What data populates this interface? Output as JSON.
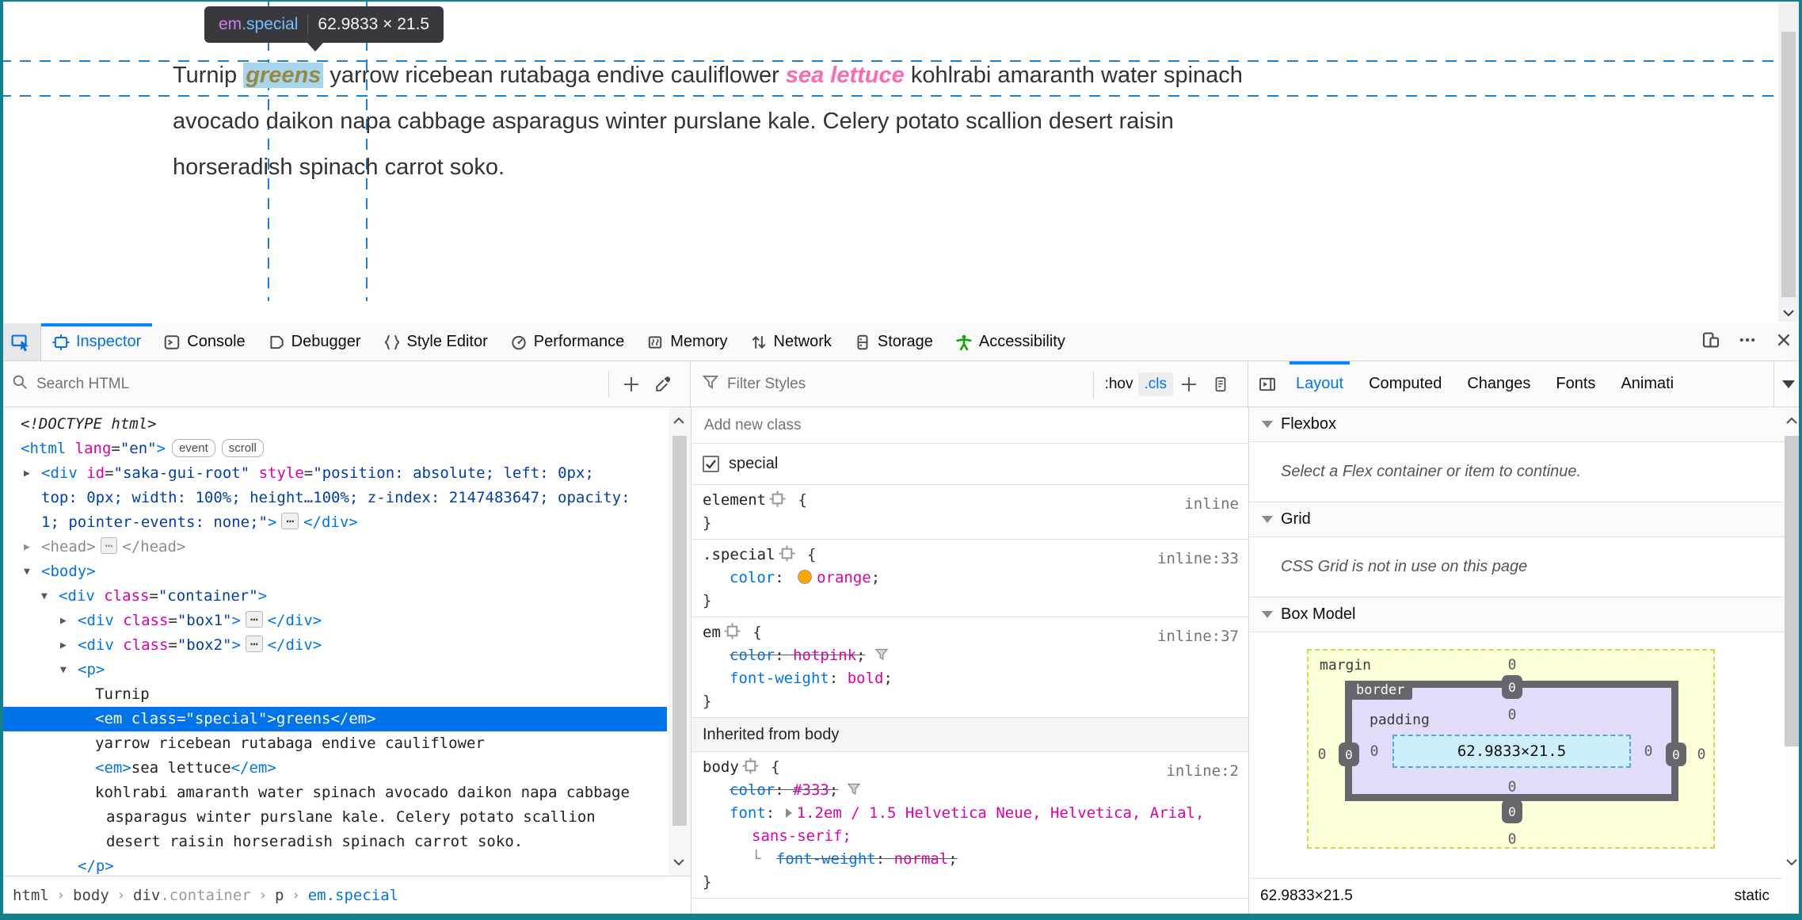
{
  "colors": {
    "accent": "#0074e8",
    "edge_teal": "#147f8e",
    "selection": "#0074e8",
    "hotpink": "#ff69b4",
    "orange_swatch": "#ffa500",
    "guide_blue": "#1a83d8"
  },
  "tooltip": {
    "tag": "em",
    "cls": ".special",
    "dims": "62.9833 × 21.5"
  },
  "page": {
    "lines": [
      [
        [
          "plain",
          "Turnip "
        ],
        [
          "special",
          "greens"
        ],
        [
          "plain",
          " yarrow ricebean rutabaga endive cauliflower "
        ],
        [
          "em",
          "sea lettuce"
        ],
        [
          "plain",
          " kohlrabi amaranth water spinach"
        ]
      ],
      [
        [
          "plain",
          "avocado daikon napa cabbage asparagus winter purslane kale. Celery potato scallion desert raisin"
        ]
      ],
      [
        [
          "plain",
          "horseradish spinach carrot soko."
        ]
      ]
    ]
  },
  "toolbar": {
    "picker_icon": "pick-element-icon",
    "tabs": [
      {
        "label": "Inspector",
        "icon": "inspector",
        "active": true
      },
      {
        "label": "Console",
        "icon": "console",
        "active": false
      },
      {
        "label": "Debugger",
        "icon": "debugger",
        "active": false
      },
      {
        "label": "Style Editor",
        "icon": "braces",
        "active": false
      },
      {
        "label": "Performance",
        "icon": "performance",
        "active": false
      },
      {
        "label": "Memory",
        "icon": "memory",
        "active": false
      },
      {
        "label": "Network",
        "icon": "network",
        "active": false
      },
      {
        "label": "Storage",
        "icon": "storage",
        "active": false
      },
      {
        "label": "Accessibility",
        "icon": "accessibility",
        "active": false
      }
    ],
    "window_buttons": [
      "responsive",
      "meatballs",
      "close"
    ]
  },
  "subbar": {
    "search_placeholder": "Search HTML",
    "filter_placeholder": "Filter Styles",
    "pseudo_label": ":hov",
    "cls_label": ".cls",
    "sidebar_tabs": [
      {
        "label": "Layout",
        "active": true
      },
      {
        "label": "Computed",
        "active": false
      },
      {
        "label": "Changes",
        "active": false
      },
      {
        "label": "Fonts",
        "active": false
      },
      {
        "label": "Animati",
        "active": false
      }
    ]
  },
  "markup": {
    "rows": [
      {
        "ind": 26,
        "parts": [
          [
            "doc",
            "<!DOCTYPE html>"
          ]
        ]
      },
      {
        "ind": 26,
        "parts": [
          [
            "tag",
            "<html"
          ],
          [
            "atn",
            " lang"
          ],
          [
            "eq",
            "="
          ],
          [
            "atv",
            "\"en\""
          ],
          [
            "tag",
            ">"
          ],
          [
            "badge",
            "event"
          ],
          [
            "badge",
            "scroll"
          ]
        ]
      },
      {
        "ind": 30,
        "exp": "closed",
        "parts": [
          [
            "tag",
            "<div"
          ],
          [
            "atn",
            " id"
          ],
          [
            "eq",
            "="
          ],
          [
            "atv",
            "\"saka-gui-root\""
          ],
          [
            "atn",
            " style"
          ],
          [
            "eq",
            "="
          ],
          [
            "atv",
            "\"position: absolute; left: 0px;"
          ]
        ]
      },
      {
        "ind": 52,
        "parts": [
          [
            "atv",
            "top: 0px; width: 100%; height…100%; z-index: 2147483647; opacity:"
          ]
        ]
      },
      {
        "ind": 52,
        "parts": [
          [
            "atv",
            "1; pointer-events: none;\""
          ],
          [
            "tag",
            ">"
          ],
          [
            "dots",
            "⋯"
          ],
          [
            "tag",
            "</div>"
          ]
        ]
      },
      {
        "ind": 30,
        "exp": "closed",
        "mut": true,
        "parts": [
          [
            "tag",
            "<head>"
          ],
          [
            "dots",
            "⋯"
          ],
          [
            "tag",
            "</head>"
          ]
        ]
      },
      {
        "ind": 30,
        "exp": "open",
        "parts": [
          [
            "tag",
            "<body>"
          ]
        ]
      },
      {
        "ind": 52,
        "exp": "open",
        "parts": [
          [
            "tag",
            "<div"
          ],
          [
            "atn",
            " class"
          ],
          [
            "eq",
            "="
          ],
          [
            "atv",
            "\"container\""
          ],
          [
            "tag",
            ">"
          ]
        ]
      },
      {
        "ind": 76,
        "exp": "closed",
        "parts": [
          [
            "tag",
            "<div"
          ],
          [
            "atn",
            " class"
          ],
          [
            "eq",
            "="
          ],
          [
            "atv",
            "\"box1\""
          ],
          [
            "tag",
            ">"
          ],
          [
            "dots",
            "⋯"
          ],
          [
            "tag",
            "</div>"
          ]
        ]
      },
      {
        "ind": 76,
        "exp": "closed",
        "parts": [
          [
            "tag",
            "<div"
          ],
          [
            "atn",
            " class"
          ],
          [
            "eq",
            "="
          ],
          [
            "atv",
            "\"box2\""
          ],
          [
            "tag",
            ">"
          ],
          [
            "dots",
            "⋯"
          ],
          [
            "tag",
            "</div>"
          ]
        ]
      },
      {
        "ind": 76,
        "exp": "open",
        "parts": [
          [
            "tag",
            "<p>"
          ]
        ]
      },
      {
        "ind": 120,
        "parts": [
          [
            "txt",
            "Turnip"
          ]
        ]
      },
      {
        "ind": 120,
        "sel": true,
        "parts": [
          [
            "tag",
            "<em"
          ],
          [
            "atn",
            " class"
          ],
          [
            "eq",
            "="
          ],
          [
            "atv",
            "\"special\""
          ],
          [
            "tag",
            ">"
          ],
          [
            "txt",
            "greens"
          ],
          [
            "tag",
            "</em>"
          ]
        ]
      },
      {
        "ind": 120,
        "parts": [
          [
            "txt",
            "yarrow ricebean rutabaga endive cauliflower"
          ]
        ]
      },
      {
        "ind": 120,
        "parts": [
          [
            "tag",
            "<em>"
          ],
          [
            "txt",
            "sea lettuce"
          ],
          [
            "tag",
            "</em>"
          ]
        ]
      },
      {
        "ind": 120,
        "parts": [
          [
            "txt",
            "kohlrabi amaranth water spinach avocado daikon napa cabbage"
          ]
        ]
      },
      {
        "ind": 134,
        "parts": [
          [
            "txt",
            "asparagus winter purslane kale. Celery potato scallion"
          ]
        ]
      },
      {
        "ind": 134,
        "parts": [
          [
            "txt",
            "desert raisin horseradish spinach carrot soko."
          ]
        ]
      },
      {
        "ind": 98,
        "parts": [
          [
            "tag",
            "</p>"
          ]
        ]
      }
    ]
  },
  "rules": {
    "add_class_placeholder": "Add new class",
    "class_toggle": {
      "checked": true,
      "label": "special"
    },
    "cards": [
      {
        "source": "inline",
        "rows": [
          {
            "parts": [
              [
                "sel",
                "element"
              ],
              [
                "ico",
                "crosshair"
              ],
              [
                "d",
                " {"
              ]
            ]
          },
          {
            "parts": [
              [
                "d",
                "}"
              ]
            ]
          }
        ]
      },
      {
        "source": "inline:33",
        "rows": [
          {
            "parts": [
              [
                "sel",
                ".special"
              ],
              [
                "ico",
                "crosshair"
              ],
              [
                "d",
                " {"
              ]
            ]
          },
          {
            "ind": 1,
            "parts": [
              [
                "p",
                "color"
              ],
              [
                "d",
                ": "
              ],
              [
                "swatch",
                "#ffa500"
              ],
              [
                "v",
                "orange"
              ],
              [
                "d",
                ";"
              ]
            ]
          },
          {
            "parts": [
              [
                "d",
                "}"
              ]
            ]
          }
        ]
      },
      {
        "source": "inline:37",
        "rows": [
          {
            "parts": [
              [
                "sel",
                "em"
              ],
              [
                "ico",
                "crosshair"
              ],
              [
                "d",
                " {"
              ]
            ]
          },
          {
            "ind": 1,
            "strike": true,
            "filter": true,
            "parts": [
              [
                "p",
                "color"
              ],
              [
                "d",
                ": "
              ],
              [
                "v",
                "hotpink"
              ],
              [
                "d",
                ";"
              ]
            ]
          },
          {
            "ind": 1,
            "parts": [
              [
                "p",
                "font-weight"
              ],
              [
                "d",
                ": "
              ],
              [
                "v",
                "bold"
              ],
              [
                "d",
                ";"
              ]
            ]
          },
          {
            "parts": [
              [
                "d",
                "}"
              ]
            ]
          }
        ]
      }
    ],
    "inherited_header": "Inherited from body",
    "inherited_cards": [
      {
        "source": "inline:2",
        "rows": [
          {
            "parts": [
              [
                "sel",
                "body"
              ],
              [
                "ico",
                "crosshair"
              ],
              [
                "d",
                " {"
              ]
            ]
          },
          {
            "ind": 1,
            "strike": true,
            "filter": true,
            "parts": [
              [
                "p",
                "color"
              ],
              [
                "d",
                ": "
              ],
              [
                "v",
                "#333"
              ],
              [
                "d",
                ";"
              ]
            ]
          },
          {
            "ind": 1,
            "parts": [
              [
                "p",
                "font"
              ],
              [
                "d",
                ": "
              ],
              [
                "tw",
                ""
              ],
              [
                "v",
                "1.2em / 1.5 Helvetica Neue, Helvetica, Arial,"
              ]
            ]
          },
          {
            "ind": 2,
            "parts": [
              [
                "v",
                "sans-serif;"
              ]
            ]
          },
          {
            "ind": 2,
            "elbow": true,
            "strike": true,
            "parts": [
              [
                "p",
                "font-weight"
              ],
              [
                "d",
                ": "
              ],
              [
                "v",
                "normal"
              ],
              [
                "d",
                ";"
              ]
            ]
          },
          {
            "parts": [
              [
                "d",
                "}"
              ]
            ]
          }
        ]
      }
    ]
  },
  "layout_panel": {
    "sections": [
      {
        "title": "Flexbox",
        "message": "Select a Flex container or item to continue."
      },
      {
        "title": "Grid",
        "message": "CSS Grid is not in use on this page"
      },
      {
        "title": "Box Model",
        "message": ""
      }
    ],
    "box_model": {
      "margin_label": "margin",
      "border_label": "border",
      "padding_label": "padding",
      "content": "62.9833×21.5",
      "margin": {
        "top": "0",
        "right": "0",
        "bottom": "0",
        "left": "0"
      },
      "border": {
        "top": "0",
        "right": "0",
        "bottom": "0",
        "left": "0"
      },
      "padding": {
        "top": "0",
        "right": "0",
        "bottom": "0",
        "left": "0"
      },
      "dims": "62.9833×21.5",
      "position": "static"
    }
  },
  "breadcrumb": {
    "items": [
      {
        "tag": "html",
        "cls": "",
        "active": false
      },
      {
        "tag": "body",
        "cls": "",
        "active": false
      },
      {
        "tag": "div",
        "cls": ".container",
        "active": false
      },
      {
        "tag": "p",
        "cls": "",
        "active": false
      },
      {
        "tag": "em",
        "cls": ".special",
        "active": true
      }
    ]
  }
}
